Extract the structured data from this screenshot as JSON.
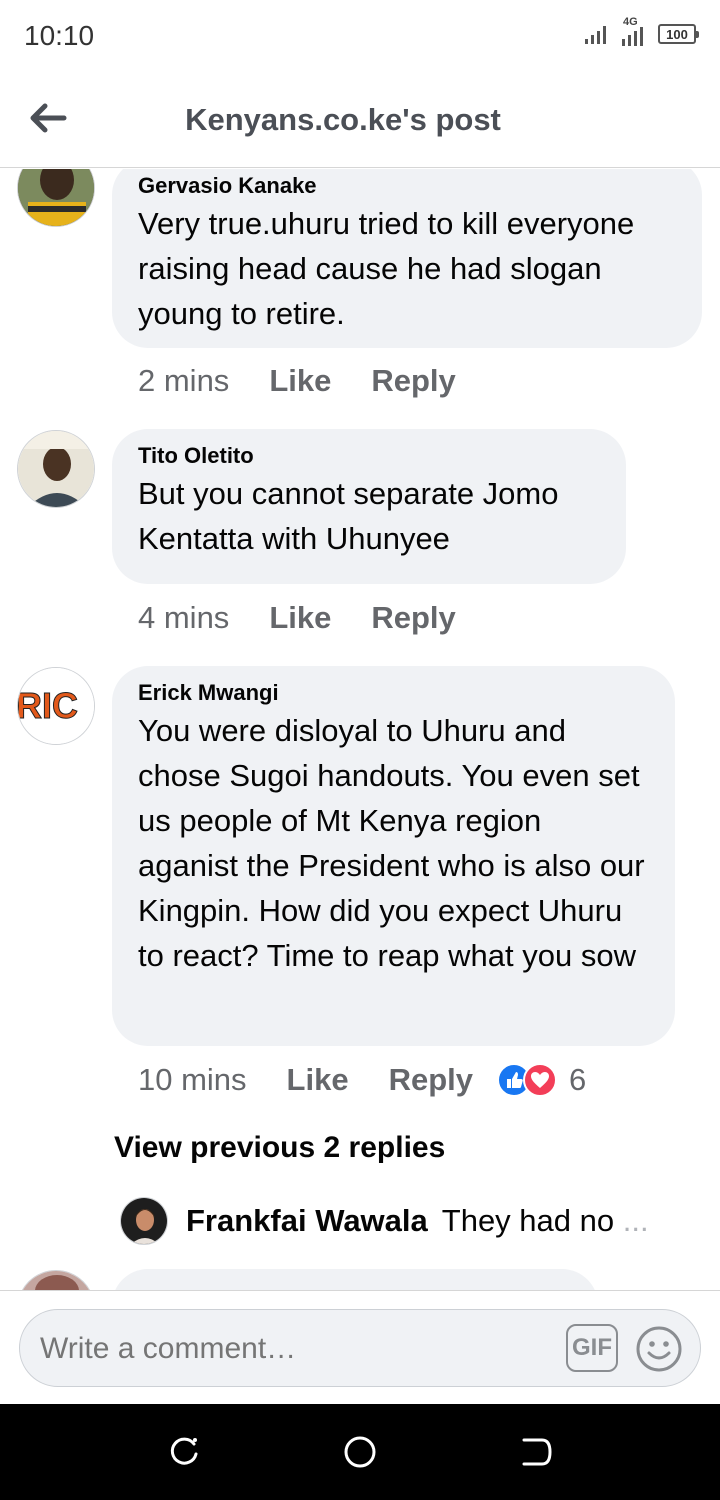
{
  "status_bar": {
    "time": "10:10",
    "network": "4G",
    "battery": "100"
  },
  "header": {
    "title": "Kenyans.co.ke's post"
  },
  "comments": [
    {
      "author": "Gervasio Kanake",
      "text": "Very true.uhuru tried to kill everyone raising head cause he had slogan young to retire.",
      "time": "2 mins",
      "like_label": "Like",
      "reply_label": "Reply"
    },
    {
      "author": "Tito Oletito",
      "text": "But you cannot separate Jomo Kentatta with Uhunyee",
      "time": "4 mins",
      "like_label": "Like",
      "reply_label": "Reply"
    },
    {
      "author": "Erick Mwangi",
      "avatar_text": "RIC",
      "text": "You were disloyal to Uhuru and chose Sugoi handouts. You even set us people of Mt Kenya region aganist the President who is also our Kingpin. How did you expect Uhuru to react? Time to reap what you sow",
      "time": "10 mins",
      "like_label": "Like",
      "reply_label": "Reply",
      "reaction_count": "6",
      "reactions": [
        "like-icon",
        "love-icon"
      ]
    }
  ],
  "view_previous": "View previous 2 replies",
  "reply_preview": {
    "author": "Frankfai Wawala",
    "text": "They had no",
    "ellipsis": "..."
  },
  "composer": {
    "placeholder": "Write a comment…",
    "gif_label": "GIF"
  },
  "colors": {
    "bubble": "#f0f2f5",
    "meta_text": "#65676b",
    "like_blue": "#1877f2",
    "love_red": "#f33e58"
  }
}
